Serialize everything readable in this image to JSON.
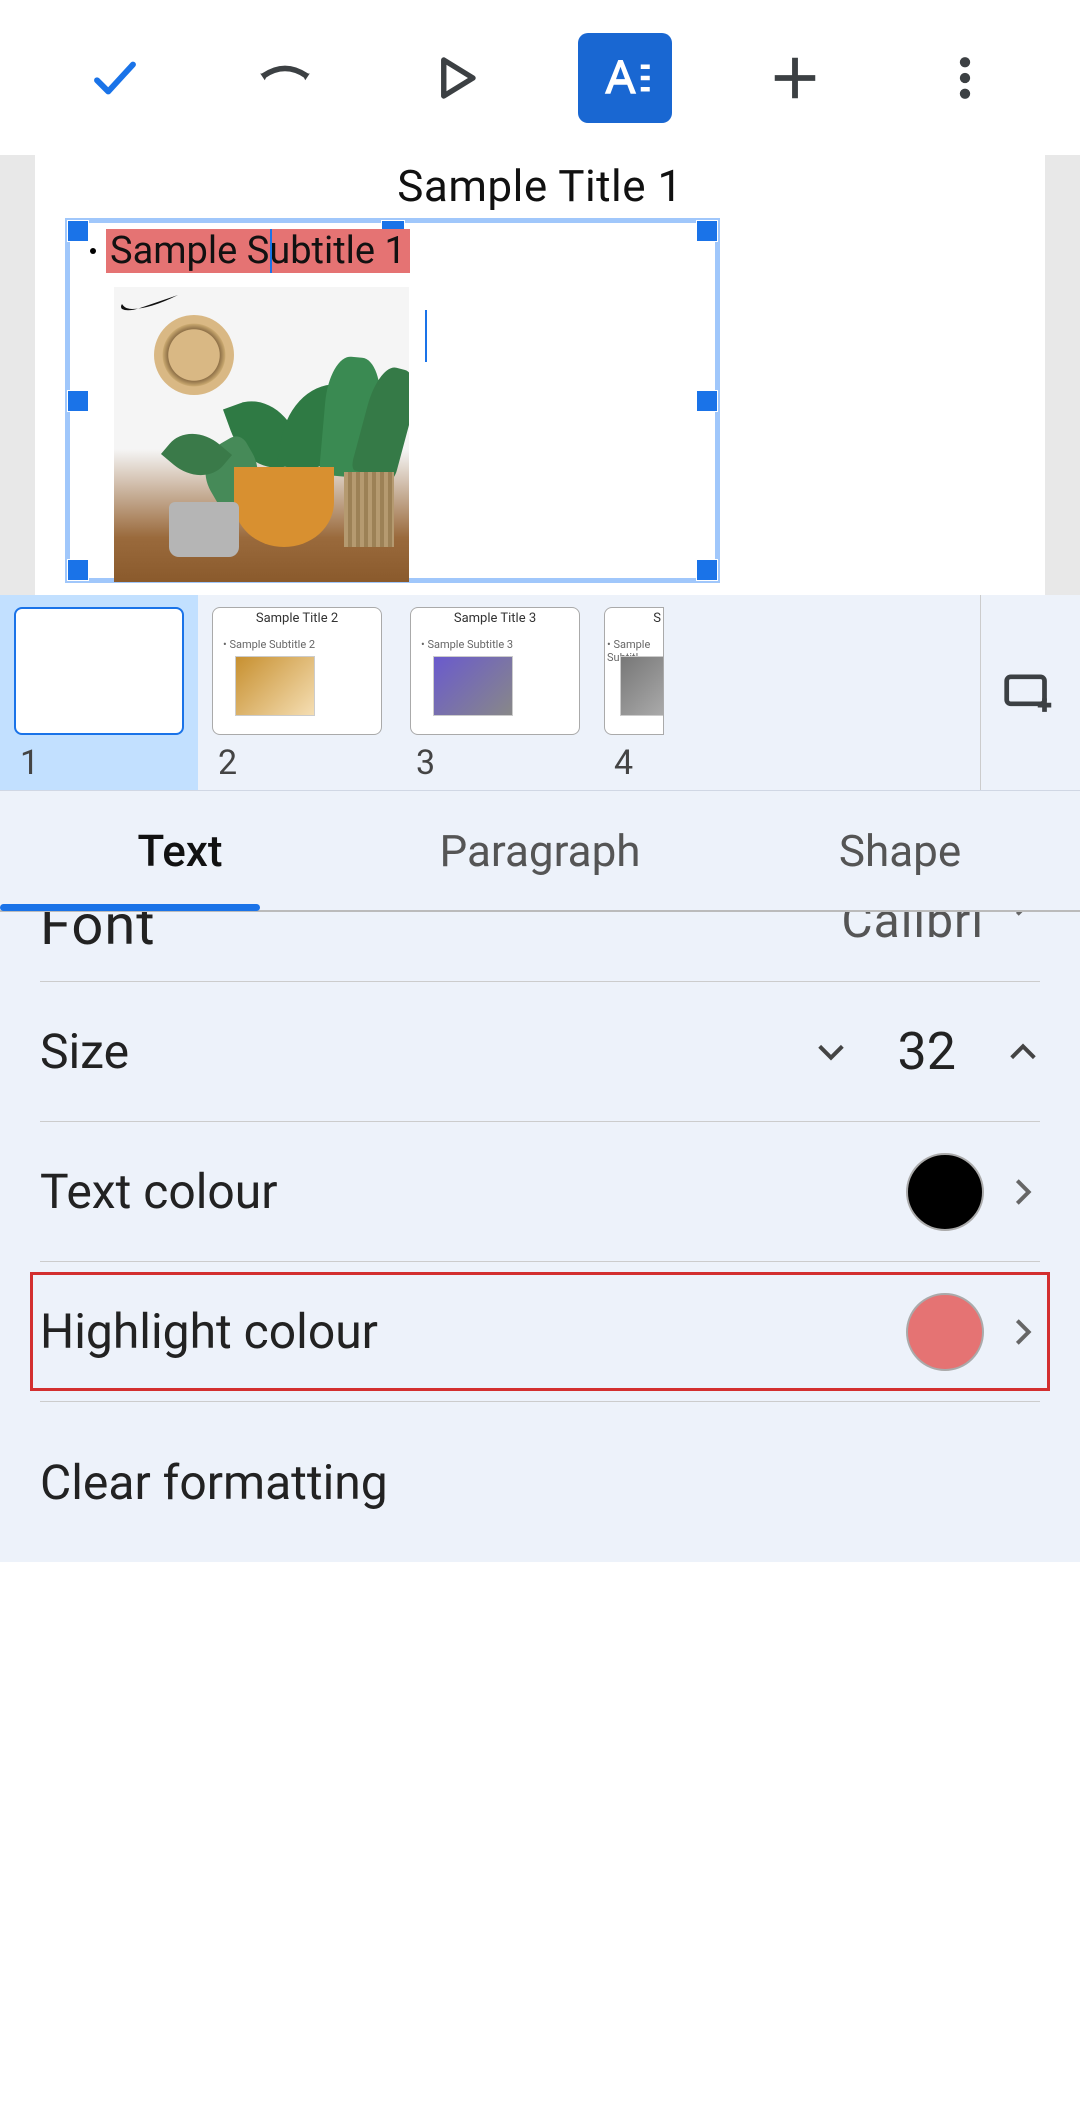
{
  "toolbar": {
    "confirm": "check",
    "undo": "undo",
    "play": "play",
    "format": "format-text",
    "add": "add",
    "more": "more"
  },
  "slide": {
    "title": "Sample Title 1",
    "subtitle": "Sample Subtitle 1"
  },
  "thumbnails": [
    {
      "num": "1",
      "title": "",
      "subtitle": "",
      "selected": true
    },
    {
      "num": "2",
      "title": "Sample Title 2",
      "subtitle": "Sample Subtitle 2",
      "selected": false
    },
    {
      "num": "3",
      "title": "Sample Title 3",
      "subtitle": "Sample Subtitle 3",
      "selected": false
    },
    {
      "num": "4",
      "title": "S",
      "subtitle": "Sample Subtitl",
      "selected": false
    }
  ],
  "tabs": {
    "text": "Text",
    "paragraph": "Paragraph",
    "shape": "Shape"
  },
  "options": {
    "font_label": "Font",
    "font_value": "Calibri",
    "size_label": "Size",
    "size_value": "32",
    "text_colour_label": "Text colour",
    "text_colour_value": "#000000",
    "highlight_label": "Highlight colour",
    "highlight_value": "#e57373",
    "clear_label": "Clear formatting"
  }
}
